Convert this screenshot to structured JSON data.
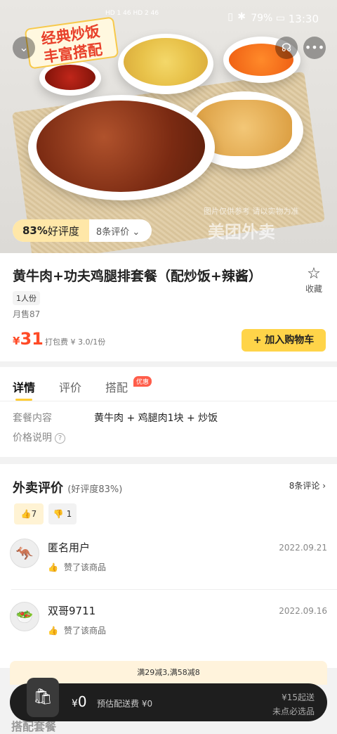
{
  "status_bar": {
    "signal": "HD 1 46 HD 2 46",
    "battery": "79%",
    "time": "13:30"
  },
  "hero": {
    "banner_line1": "经典炒饭",
    "banner_line2": "丰富搭配",
    "rating_good": "83%",
    "rating_good_suffix": "好评度",
    "review_count": "8条评价",
    "watermark_note": "图片仅供参考 请以实物为准",
    "watermark": "美团外卖"
  },
  "product": {
    "title": "黄牛肉+功夫鸡腿排套餐（配炒饭+辣酱）",
    "favorite_label": "收藏",
    "portion_tag": "1人份",
    "monthly_sales": "月售87",
    "price_symbol": "¥",
    "price": "31",
    "packing_fee": "打包费 ¥ 3.0/1份",
    "add_to_cart": "+ 加入购物车"
  },
  "tabs": [
    {
      "label": "详情"
    },
    {
      "label": "评价"
    },
    {
      "label": "搭配"
    }
  ],
  "tab_badge": "优惠",
  "details": {
    "set_label": "套餐内容",
    "set_value": "黄牛肉 + 鸡腿肉1块 + 炒饭",
    "price_info_label": "价格说明"
  },
  "reviews": {
    "title": "外卖评价",
    "good_rate": "(好评度83%)",
    "count_link": "8条评论",
    "thumbs_up_count": "7",
    "thumbs_down_count": "1",
    "items": [
      {
        "user": "匿名用户",
        "date": "2022.09.21",
        "text": "赞了该商品"
      },
      {
        "user": "双哥9711",
        "date": "2022.09.16",
        "text": "赞了该商品"
      }
    ]
  },
  "cart": {
    "discount": "满29减3,满58减8",
    "amount_symbol": "¥",
    "amount": "0",
    "delivery_fee": "预估配送费 ¥0",
    "min_order": "¥15起送",
    "min_note": "未点必选品"
  },
  "next_section": "搭配套餐"
}
